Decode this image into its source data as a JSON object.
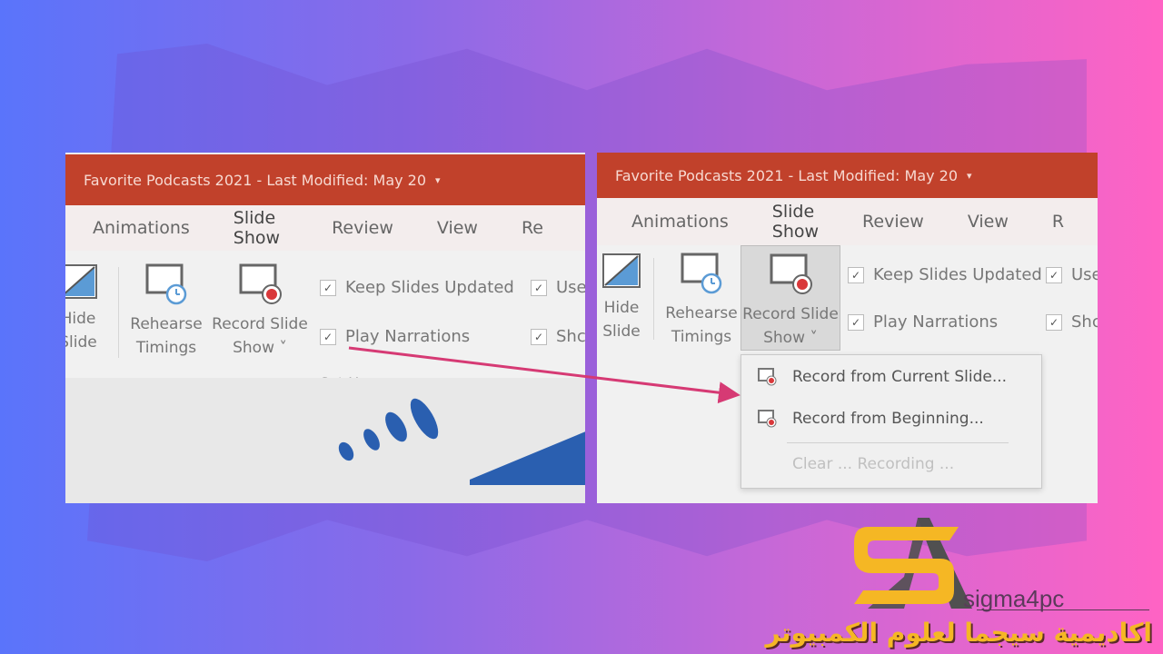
{
  "left_window": {
    "title": "Favorite Podcasts 2021  -  Last Modified: May 20",
    "tabs": [
      {
        "label": "Animations",
        "active": false
      },
      {
        "label": "Slide Show",
        "active": true
      },
      {
        "label": "Review",
        "active": false
      },
      {
        "label": "View",
        "active": false
      },
      {
        "label": "Re",
        "active": false
      }
    ],
    "ribbon": {
      "hide_slide": "Hide Slide",
      "rehearse_timings": "Rehearse Timings",
      "record_slide_show": "Record Slide Show ˅",
      "checkboxes": [
        {
          "label": "Keep Slides Updated",
          "checked": true
        },
        {
          "label": "Play Narrations",
          "checked": true
        },
        {
          "label": "Use",
          "checked": true
        },
        {
          "label": "Shc",
          "checked": true
        }
      ],
      "group_label": "Set Up"
    }
  },
  "right_window": {
    "title": "Favorite Podcasts 2021  -  Last Modified: May 20",
    "tabs": [
      {
        "label": "Animations",
        "active": false
      },
      {
        "label": "Slide Show",
        "active": true
      },
      {
        "label": "Review",
        "active": false
      },
      {
        "label": "View",
        "active": false
      },
      {
        "label": "R",
        "active": false
      }
    ],
    "ribbon": {
      "hide_slide": "Hide Slide",
      "rehearse_timings": "Rehearse Timings",
      "record_slide_show": "Record Slide Show ˅",
      "checkboxes": [
        {
          "label": "Keep Slides Updated",
          "checked": true
        },
        {
          "label": "Play Narrations",
          "checked": true
        },
        {
          "label": "Use",
          "checked": true
        },
        {
          "label": "Shc",
          "checked": true
        }
      ]
    },
    "dropdown_menu": [
      {
        "label": "Record from Current Slide...",
        "enabled": true
      },
      {
        "label": "Record from Beginning...",
        "enabled": true
      },
      {
        "label": "Clear ... Recording ...",
        "enabled": false
      }
    ]
  },
  "colors": {
    "title_bar": "#c1412b",
    "arrow": "#d63a74",
    "record_dot": "#d9383a",
    "logo_yellow": "#f5b724",
    "logo_gray": "#505050"
  },
  "logo": {
    "brand": "sigma4pc",
    "arabic_tagline": "اكاديمية سيجما لعلوم الكمبيوتر"
  },
  "caret_glyph": "▾",
  "check_glyph": "✓"
}
